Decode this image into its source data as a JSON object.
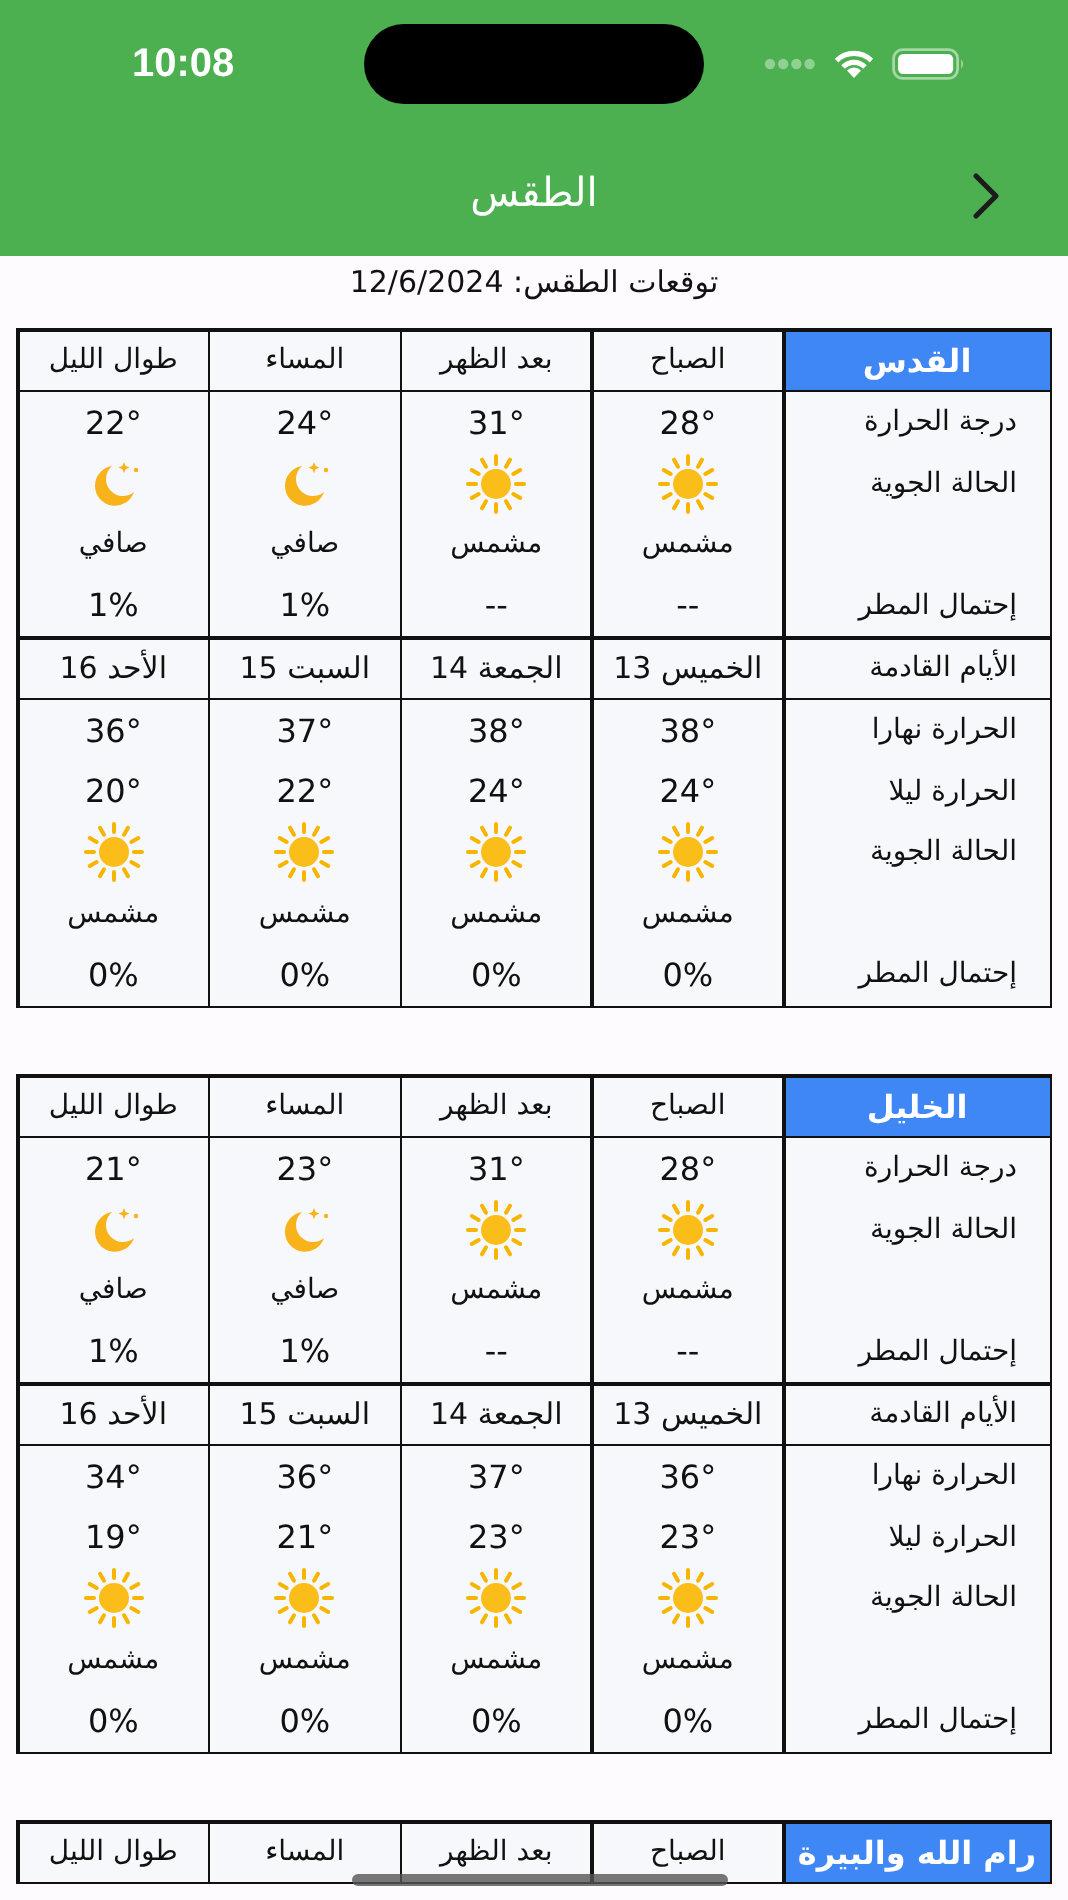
{
  "status_bar": {
    "time": "10:08"
  },
  "nav": {
    "title": "الطقس"
  },
  "forecast_date": "توقعات الطقس: 12/6/2024",
  "cities": [
    {
      "name": "القدس",
      "row_labels": {
        "temp": "درجة الحرارة",
        "condition": "الحالة الجوية",
        "rain": "إحتمال المطر",
        "days": "الأيام القادمة",
        "high": "الحرارة نهارا",
        "low": "الحرارة ليلا",
        "day_condition": "الحالة الجوية",
        "day_rain": "إحتمال المطر"
      },
      "periods": [
        {
          "label": "الصباح",
          "temp": "28°",
          "kind": "sun",
          "condition": "مشمس",
          "rain": "--"
        },
        {
          "label": "بعد الظهر",
          "temp": "31°",
          "kind": "sun",
          "condition": "مشمس",
          "rain": "--"
        },
        {
          "label": "المساء",
          "temp": "24°",
          "kind": "moon",
          "condition": "صافي",
          "rain": "1%"
        },
        {
          "label": "طوال الليل",
          "temp": "22°",
          "kind": "moon",
          "condition": "صافي",
          "rain": "1%"
        }
      ],
      "days": [
        {
          "label": "الخميس 13",
          "high": "38°",
          "low": "24°",
          "kind": "sun",
          "condition": "مشمس",
          "rain": "0%"
        },
        {
          "label": "الجمعة 14",
          "high": "38°",
          "low": "24°",
          "kind": "sun",
          "condition": "مشمس",
          "rain": "0%"
        },
        {
          "label": "السبت 15",
          "high": "37°",
          "low": "22°",
          "kind": "sun",
          "condition": "مشمس",
          "rain": "0%"
        },
        {
          "label": "الأحد 16",
          "high": "36°",
          "low": "20°",
          "kind": "sun",
          "condition": "مشمس",
          "rain": "0%"
        }
      ]
    },
    {
      "name": "الخليل",
      "row_labels": {
        "temp": "درجة الحرارة",
        "condition": "الحالة الجوية",
        "rain": "إحتمال المطر",
        "days": "الأيام القادمة",
        "high": "الحرارة نهارا",
        "low": "الحرارة ليلا",
        "day_condition": "الحالة الجوية",
        "day_rain": "إحتمال المطر"
      },
      "periods": [
        {
          "label": "الصباح",
          "temp": "28°",
          "kind": "sun",
          "condition": "مشمس",
          "rain": "--"
        },
        {
          "label": "بعد الظهر",
          "temp": "31°",
          "kind": "sun",
          "condition": "مشمس",
          "rain": "--"
        },
        {
          "label": "المساء",
          "temp": "23°",
          "kind": "moon",
          "condition": "صافي",
          "rain": "1%"
        },
        {
          "label": "طوال الليل",
          "temp": "21°",
          "kind": "moon",
          "condition": "صافي",
          "rain": "1%"
        }
      ],
      "days": [
        {
          "label": "الخميس 13",
          "high": "36°",
          "low": "23°",
          "kind": "sun",
          "condition": "مشمس",
          "rain": "0%"
        },
        {
          "label": "الجمعة 14",
          "high": "37°",
          "low": "23°",
          "kind": "sun",
          "condition": "مشمس",
          "rain": "0%"
        },
        {
          "label": "السبت 15",
          "high": "36°",
          "low": "21°",
          "kind": "sun",
          "condition": "مشمس",
          "rain": "0%"
        },
        {
          "label": "الأحد 16",
          "high": "34°",
          "low": "19°",
          "kind": "sun",
          "condition": "مشمس",
          "rain": "0%"
        }
      ]
    },
    {
      "name": "رام الله والبيرة",
      "periods": [
        {
          "label": "الصباح"
        },
        {
          "label": "بعد الظهر"
        },
        {
          "label": "المساء"
        },
        {
          "label": "طوال الليل"
        }
      ]
    }
  ]
}
